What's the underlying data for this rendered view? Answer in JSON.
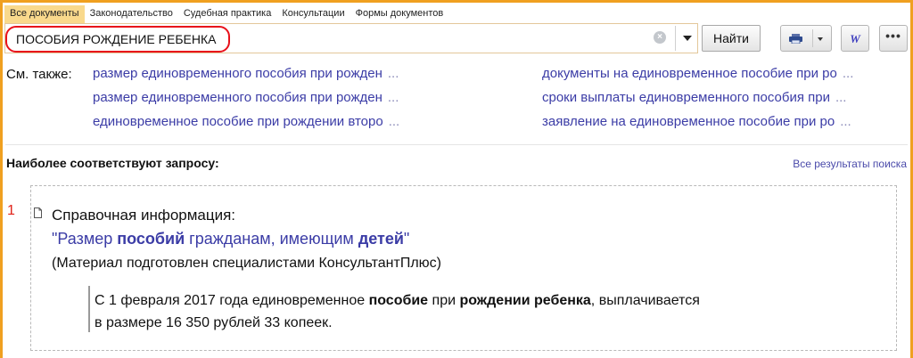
{
  "tabs": [
    {
      "label": "Все документы",
      "active": true
    },
    {
      "label": "Законодательство",
      "active": false
    },
    {
      "label": "Судебная практика",
      "active": false
    },
    {
      "label": "Консультации",
      "active": false
    },
    {
      "label": "Формы документов",
      "active": false
    }
  ],
  "search": {
    "value": "ПОСОБИЯ РОЖДЕНИЕ РЕБЕНКА",
    "button_label": "Найти",
    "clear_glyph": "×"
  },
  "toolbar": {
    "word_label": "W",
    "more_label": "•••"
  },
  "see_also": {
    "label": "См. также:",
    "ellipsis": "...",
    "left": [
      "размер единовременного пособия при рожден",
      "размер единовременного пособия при рожден",
      "единовременное пособие при рождении второ"
    ],
    "right": [
      "документы на единовременное пособие при ро",
      "сроки выплаты единовременного пособия при",
      "заявление на единовременное пособие при ро"
    ]
  },
  "best": {
    "title": "Наиболее соответствуют запросу:",
    "all_results": "Все результаты поиска"
  },
  "result": {
    "number": "1",
    "category": "Справочная информация:",
    "title_parts": [
      "\"Размер ",
      "пособий",
      " гражданам, имеющим ",
      "детей",
      "\""
    ],
    "subtitle": "(Материал подготовлен специалистами КонсультантПлюс)",
    "snippet_line1_parts": [
      "С 1 февраля 2017 года единовременное ",
      "пособие",
      " при ",
      "рождении ребенка",
      ", выплачивается"
    ],
    "snippet_line2": "в размере 16 350 рублей 33 копеек."
  },
  "colors": {
    "accent": "#f0a020",
    "link": "#3b3ca6",
    "highlight": "#e8101a",
    "tab_active": "#f9d98c"
  }
}
